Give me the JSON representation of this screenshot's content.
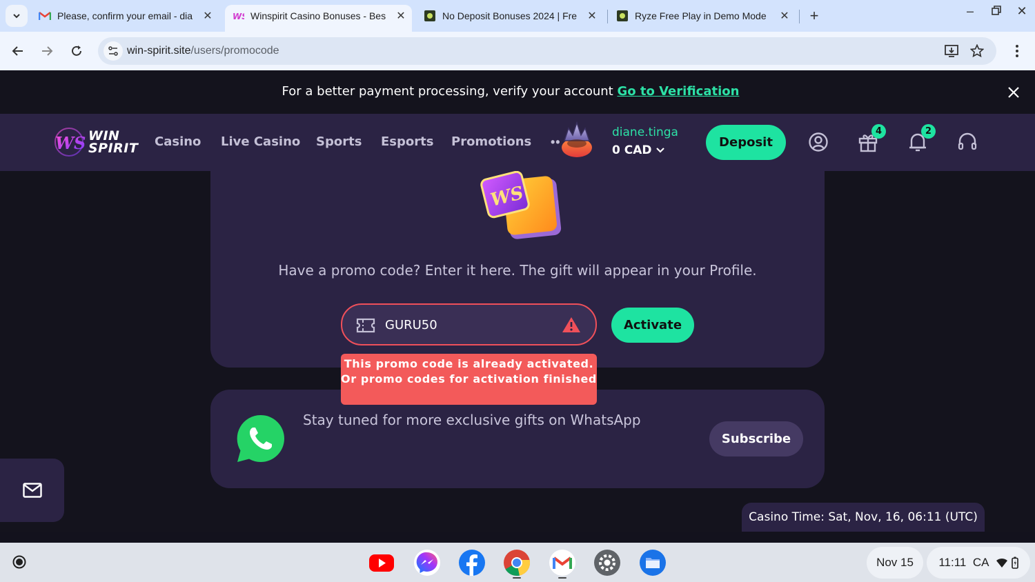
{
  "browser": {
    "tabs": [
      {
        "title": "Please, confirm your email - dia",
        "favicon": "gmail-icon",
        "active": false
      },
      {
        "title": "Winspirit Casino Bonuses - Bes",
        "favicon": "winspirit-icon",
        "active": true
      },
      {
        "title": "No Deposit Bonuses 2024 | Fre",
        "favicon": "guru-icon",
        "active": false
      },
      {
        "title": "Ryze Free Play in Demo Mode",
        "favicon": "guru-icon",
        "active": false
      }
    ],
    "url_host": "win-spirit.site",
    "url_path": "/users/promocode"
  },
  "verify_banner": {
    "text": "For a better payment processing, verify your account ",
    "link": "Go to Verification"
  },
  "header": {
    "logo_line1": "WIN",
    "logo_line2": "SPIRIT",
    "nav": [
      "Casino",
      "Live Casino",
      "Sports",
      "Esports",
      "Promotions"
    ],
    "more": "••",
    "username": "diane.tinga",
    "balance": "0 CAD",
    "deposit_label": "Deposit",
    "gift_badge": "4",
    "bell_badge": "2"
  },
  "promo": {
    "hint": "Have a promo code? Enter it here. The gift will appear in your Profile.",
    "input_value": "GURU50",
    "activate_label": "Activate",
    "error": "This promo code is already activated. Or promo codes for activation finished"
  },
  "whatsapp": {
    "text": "Stay tuned for more exclusive gifts on WhatsApp",
    "subscribe_label": "Subscribe"
  },
  "casino_time": "Casino Time: Sat, Nov, 16, 06:11 (UTC)",
  "shelf": {
    "apps": [
      "youtube-icon",
      "messenger-icon",
      "facebook-icon",
      "chrome-icon",
      "gmail-icon",
      "settings-icon",
      "files-icon"
    ],
    "date": "Nov 15",
    "time": "11:11",
    "region": "CA"
  },
  "colors": {
    "accent": "#1ee3a1",
    "panel": "#2b2344",
    "page_bg": "#14131d",
    "error": "#f35a5a"
  }
}
